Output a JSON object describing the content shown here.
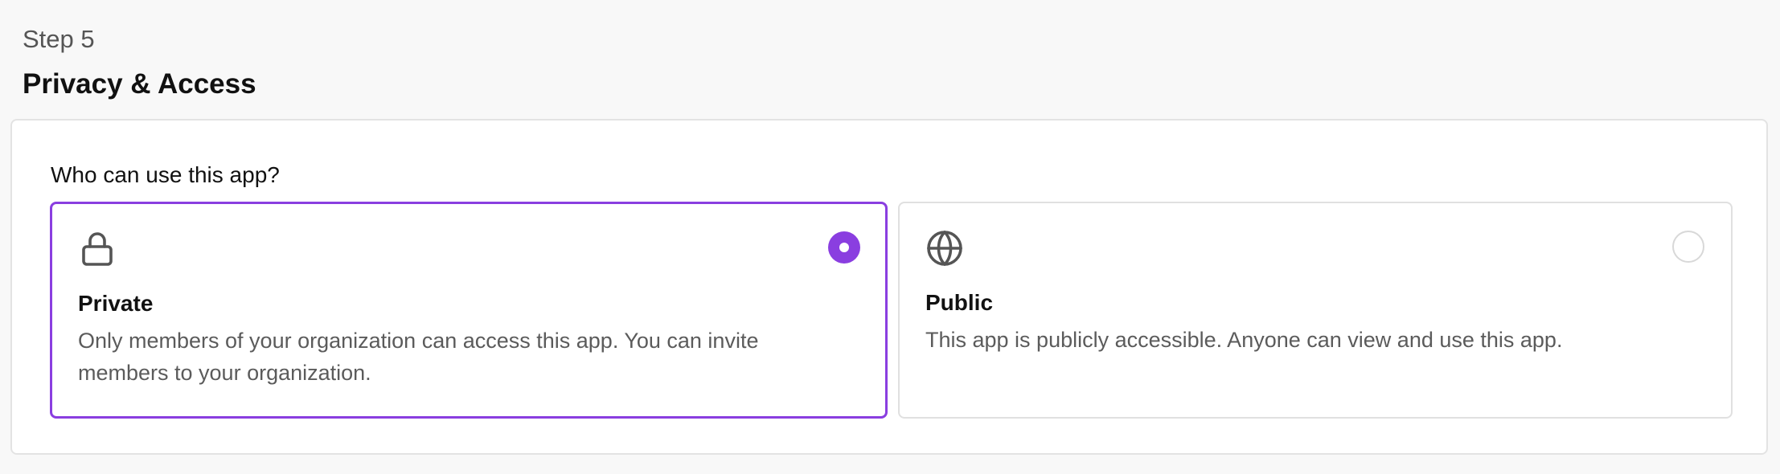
{
  "header": {
    "step_label": "Step 5",
    "title": "Privacy & Access"
  },
  "form": {
    "question": "Who can use this app?",
    "selected": "private",
    "options": [
      {
        "id": "private",
        "icon": "lock-icon",
        "title": "Private",
        "description": "Only members of your organization can access this app. You can invite members to your organization.",
        "selected": true
      },
      {
        "id": "public",
        "icon": "globe-icon",
        "title": "Public",
        "description": "This app is publicly accessible. Anyone can view and use this app.",
        "selected": false
      }
    ]
  },
  "colors": {
    "accent": "#8a3ee0",
    "background": "#f8f8f8",
    "card": "#ffffff",
    "muted_text": "#5b5b5b"
  }
}
